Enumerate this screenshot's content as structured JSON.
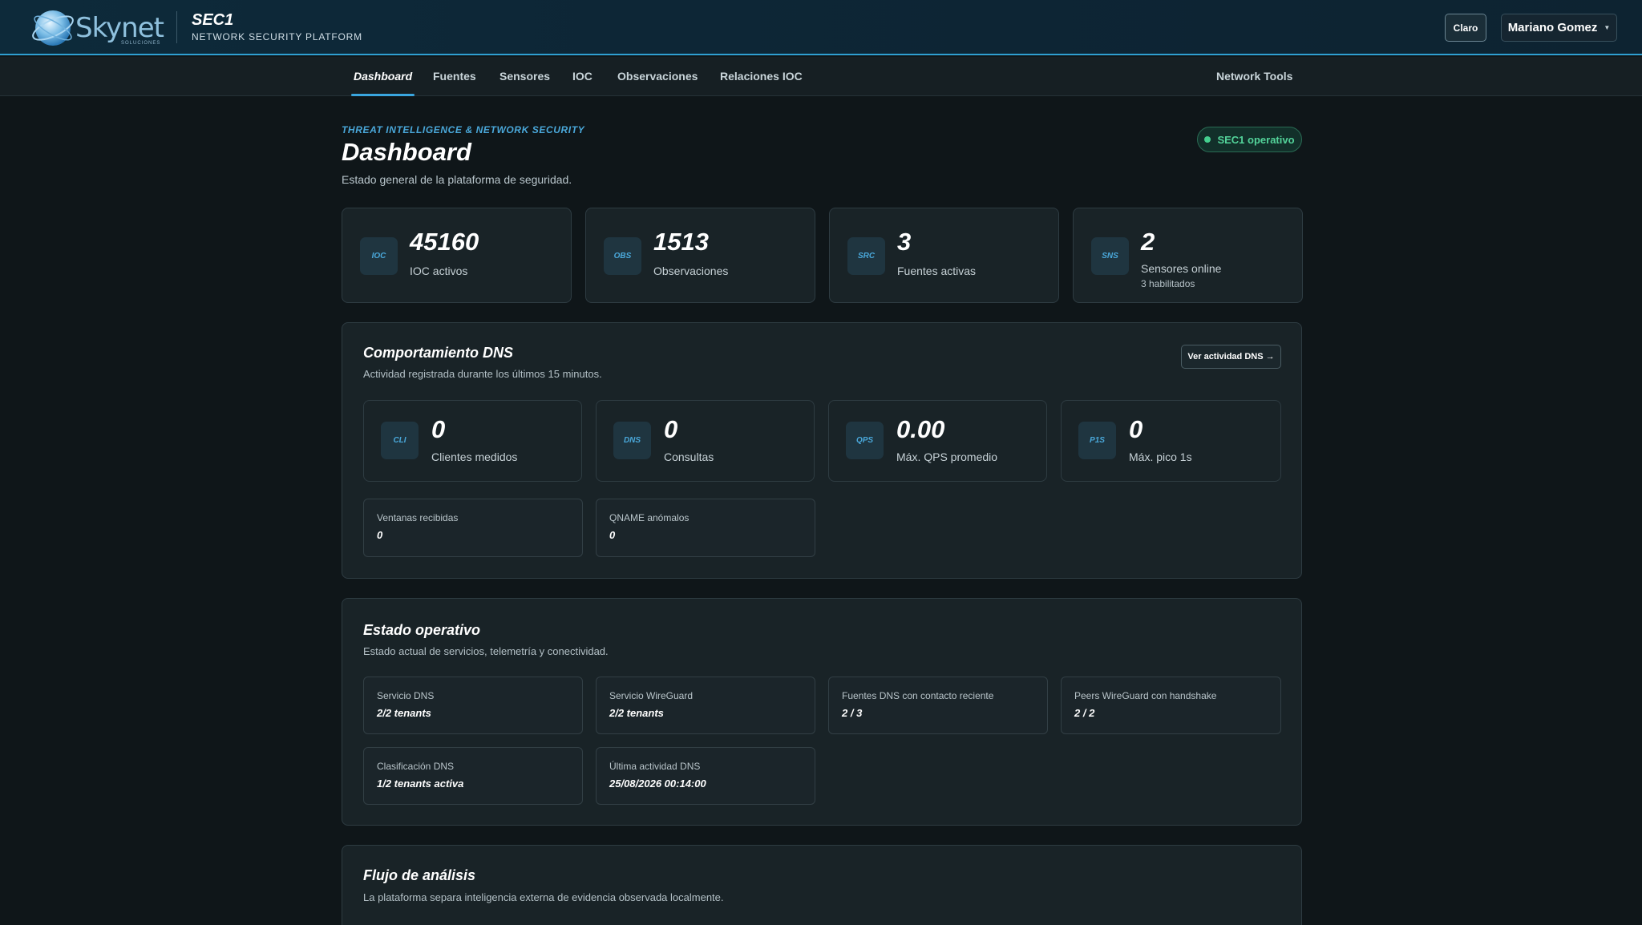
{
  "header": {
    "logo_text": "Skynet",
    "logo_sub": "SOLUCIONES",
    "app_title": "SEC1",
    "app_subtitle": "NETWORK SECURITY PLATFORM",
    "theme_button": "Claro",
    "user_name": "Mariano Gomez"
  },
  "nav": {
    "items": [
      "Dashboard",
      "Fuentes",
      "Sensores",
      "IOC",
      "Observaciones",
      "Relaciones IOC"
    ],
    "right": "Network Tools"
  },
  "page": {
    "eyebrow": "THREAT INTELLIGENCE & NETWORK SECURITY",
    "title": "Dashboard",
    "subtitle": "Estado general de la plataforma de seguridad.",
    "status": "SEC1 operativo"
  },
  "stats": [
    {
      "badge": "IOC",
      "value": "45160",
      "label": "IOC activos",
      "extra": ""
    },
    {
      "badge": "OBS",
      "value": "1513",
      "label": "Observaciones",
      "extra": ""
    },
    {
      "badge": "SRC",
      "value": "3",
      "label": "Fuentes activas",
      "extra": ""
    },
    {
      "badge": "SNS",
      "value": "2",
      "label": "Sensores online",
      "extra": "3 habilitados"
    }
  ],
  "dns": {
    "title": "Comportamiento DNS",
    "subtitle": "Actividad registrada durante los últimos 15 minutos.",
    "button": "Ver actividad DNS →",
    "metrics": [
      {
        "badge": "CLI",
        "value": "0",
        "label": "Clientes medidos"
      },
      {
        "badge": "DNS",
        "value": "0",
        "label": "Consultas"
      },
      {
        "badge": "QPS",
        "value": "0.00",
        "label": "Máx. QPS promedio"
      },
      {
        "badge": "P1S",
        "value": "0",
        "label": "Máx. pico 1s"
      }
    ],
    "extras": [
      {
        "label": "Ventanas recibidas",
        "value": "0"
      },
      {
        "label": "QNAME anómalos",
        "value": "0"
      }
    ]
  },
  "ops": {
    "title": "Estado operativo",
    "subtitle": "Estado actual de servicios, telemetría y conectividad.",
    "items": [
      {
        "label": "Servicio DNS",
        "value": "2/2 tenants"
      },
      {
        "label": "Servicio WireGuard",
        "value": "2/2 tenants"
      },
      {
        "label": "Fuentes DNS con contacto reciente",
        "value": "2 / 3"
      },
      {
        "label": "Peers WireGuard con handshake",
        "value": "2 / 2"
      },
      {
        "label": "Clasificación DNS",
        "value": "1/2 tenants activa"
      },
      {
        "label": "Última actividad DNS",
        "value": "25/08/2026 00:14:00"
      }
    ]
  },
  "flow": {
    "title": "Flujo de análisis",
    "subtitle": "La plataforma separa inteligencia externa de evidencia observada localmente."
  }
}
